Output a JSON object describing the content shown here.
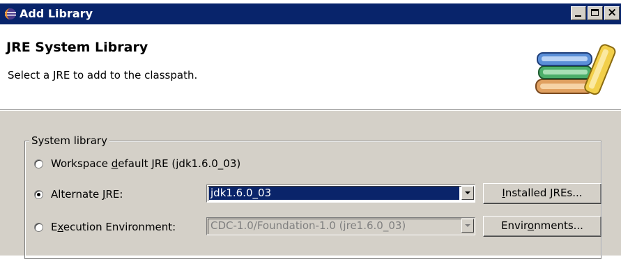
{
  "window": {
    "title": "Add Library"
  },
  "header": {
    "title": "JRE System Library",
    "description": "Select a JRE to add to the classpath."
  },
  "system_library": {
    "legend": "System library",
    "workspace_default": {
      "label_pre": "Workspace ",
      "label_mnemonic": "d",
      "label_post": "efault JRE (jdk1.6.0_03)",
      "selected": false
    },
    "alternate_jre": {
      "label_pre": "Alternate ",
      "label_mnemonic": "J",
      "label_post": "RE:",
      "selected": true,
      "value": "jdk1.6.0_03"
    },
    "execution_env": {
      "label_pre": "E",
      "label_mnemonic": "x",
      "label_post": "ecution Environment:",
      "selected": false,
      "value": "CDC-1.0/Foundation-1.0 (jre1.6.0_03)"
    },
    "installed_jres_button": {
      "label_mnemonic": "I",
      "label_post": "nstalled JREs..."
    },
    "environments_button": {
      "label_pre": "Envir",
      "label_mnemonic": "o",
      "label_post": "nments..."
    }
  },
  "colors": {
    "titlebar": "#08246b",
    "dialog_face": "#d4d0c8",
    "selection": "#0a246a"
  },
  "icons": {
    "title_icon": "eclipse-icon",
    "header_icon": "library-books-icon"
  }
}
